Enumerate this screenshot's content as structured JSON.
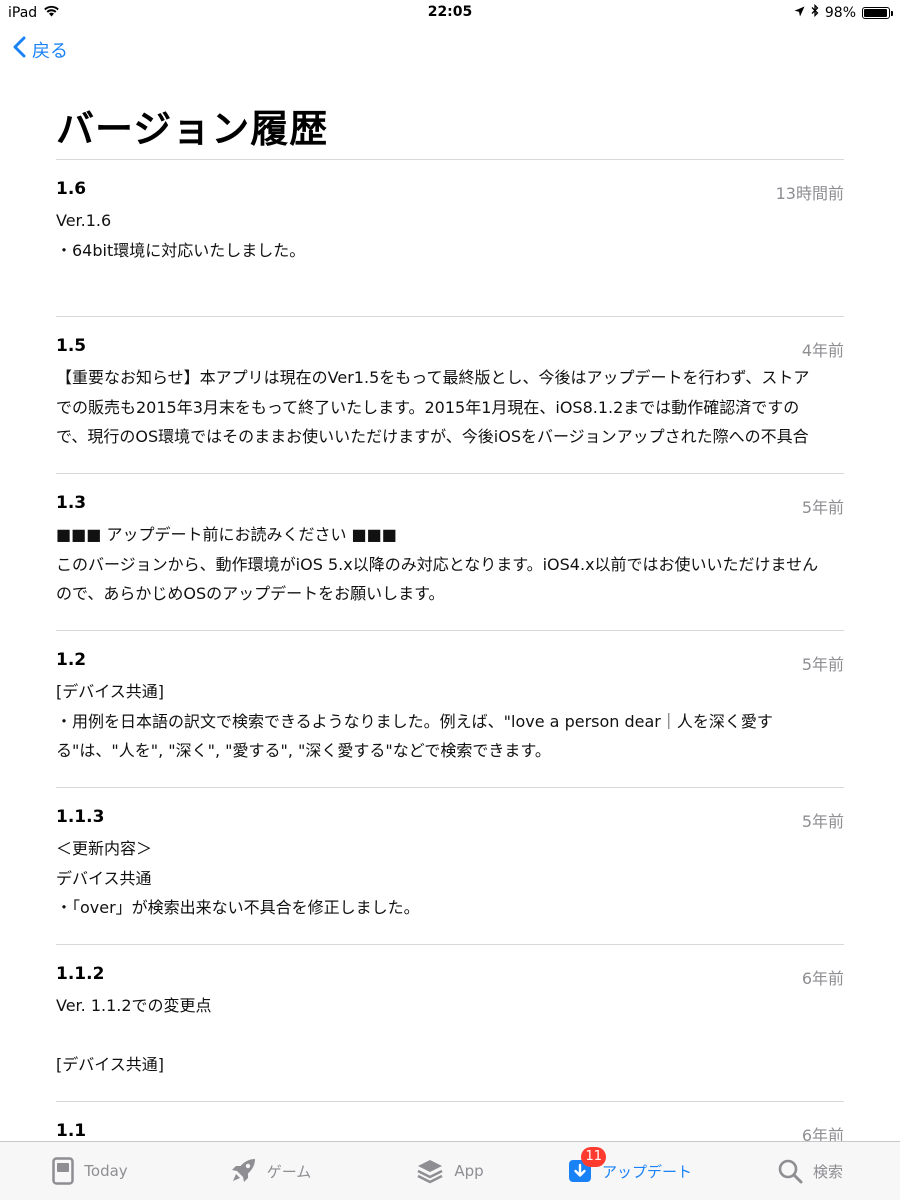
{
  "status_bar": {
    "device": "iPad",
    "time": "22:05",
    "battery": "98%",
    "battery_level": 0.98
  },
  "nav": {
    "back_label": "戻る"
  },
  "page": {
    "title": "バージョン履歴"
  },
  "versions": [
    {
      "version": "1.6",
      "date": "13時間前",
      "lines": [
        "Ver.1.6",
        "・64bit環境に対応いたしました。"
      ]
    },
    {
      "version": "1.5",
      "date": "4年前",
      "lines": [
        "【重要なお知らせ】本アプリは現在のVer1.5をもって最終版とし、今後はアップデートを行わず、ストア",
        "での販売も2015年3月末をもって終了いたします。2015年1月現在、iOS8.1.2までは動作確認済ですの",
        "で、現行のOS環境ではそのままお使いいただけますが、今後iOSをバージョンアップされた際への不具合"
      ]
    },
    {
      "version": "1.3",
      "date": "5年前",
      "lines": [
        "■■■ アップデート前にお読みください ■■■",
        "このバージョンから、動作環境がiOS 5.x以降のみ対応となります。iOS4.x以前ではお使いいただけません",
        "ので、あらかじめOSのアップデートをお願いします。"
      ]
    },
    {
      "version": "1.2",
      "date": "5年前",
      "lines": [
        "[デバイス共通]",
        "・用例を日本語の訳文で検索できるようなりました。例えば、\"love a person dear｜人を深く愛す",
        "る\"は、\"人を\", \"深く\", \"愛する\", \"深く愛する\"などで検索できます。"
      ]
    },
    {
      "version": "1.1.3",
      "date": "5年前",
      "lines": [
        "＜更新内容＞",
        "デバイス共通",
        "・「over」が検索出来ない不具合を修正しました。"
      ]
    },
    {
      "version": "1.1.2",
      "date": "6年前",
      "lines": [
        "Ver. 1.1.2での変更点",
        "",
        "[デバイス共通]"
      ]
    },
    {
      "version": "1.1",
      "date": "6年前",
      "lines": []
    }
  ],
  "tab_bar": {
    "items": [
      {
        "label": "Today",
        "icon": "today-icon"
      },
      {
        "label": "ゲーム",
        "icon": "rocket-icon"
      },
      {
        "label": "App",
        "icon": "app-stack-icon"
      },
      {
        "label": "アップデート",
        "icon": "download-icon",
        "badge": "11",
        "active": true
      },
      {
        "label": "検索",
        "icon": "search-icon"
      }
    ]
  },
  "colors": {
    "accent": "#1a82f7",
    "badge": "#ff3b30",
    "secondary_text": "#8e8e93"
  }
}
